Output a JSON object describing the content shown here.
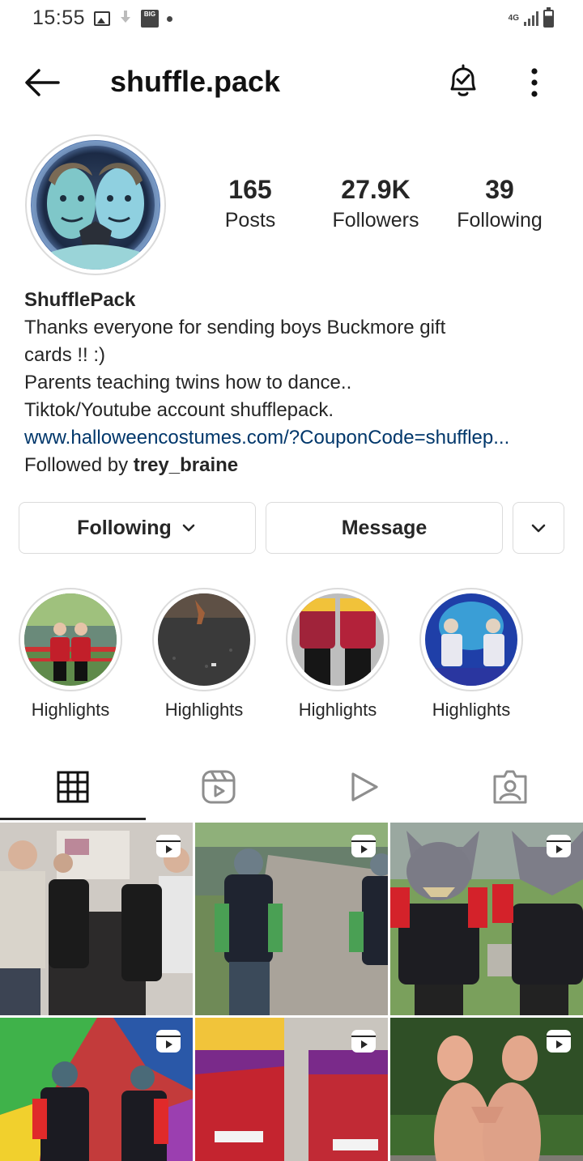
{
  "status_bar": {
    "time": "15:55",
    "big_badge": "BIG",
    "network": "4G"
  },
  "header": {
    "username": "shuffle.pack"
  },
  "stats": {
    "posts_count": "165",
    "posts_label": "Posts",
    "followers_count": "27.9K",
    "followers_label": "Followers",
    "following_count": "39",
    "following_label": "Following"
  },
  "bio": {
    "display_name": "ShufflePack",
    "line1": "Thanks everyone for sending boys Buckmore gift",
    "line2": "cards !! :)",
    "line3": "Parents teaching twins how to dance..",
    "line4": "Tiktok/Youtube account shufflepack.",
    "link": "www.halloweencostumes.com/?CouponCode=shufflep...",
    "followed_by_prefix": "Followed by ",
    "followed_by_user": "trey_braine"
  },
  "actions": {
    "following_label": "Following",
    "message_label": "Message"
  },
  "highlights": [
    {
      "label": "Highlights"
    },
    {
      "label": "Highlights"
    },
    {
      "label": "Highlights"
    },
    {
      "label": "Highlights"
    }
  ],
  "tabs": [
    {
      "icon": "grid-icon",
      "active": true
    },
    {
      "icon": "reels-icon",
      "active": false
    },
    {
      "icon": "play-icon",
      "active": false
    },
    {
      "icon": "tagged-icon",
      "active": false
    }
  ],
  "posts": [
    {
      "type": "reel",
      "icon": "reel-icon"
    },
    {
      "type": "reel",
      "icon": "reel-icon"
    },
    {
      "type": "reel",
      "icon": "reel-icon"
    },
    {
      "type": "reel",
      "icon": "reel-icon"
    },
    {
      "type": "reel",
      "icon": "reel-icon"
    },
    {
      "type": "reel",
      "icon": "reel-icon"
    }
  ],
  "colors": {
    "text": "#262626",
    "link": "#00376b",
    "border": "#dbdbdb"
  }
}
